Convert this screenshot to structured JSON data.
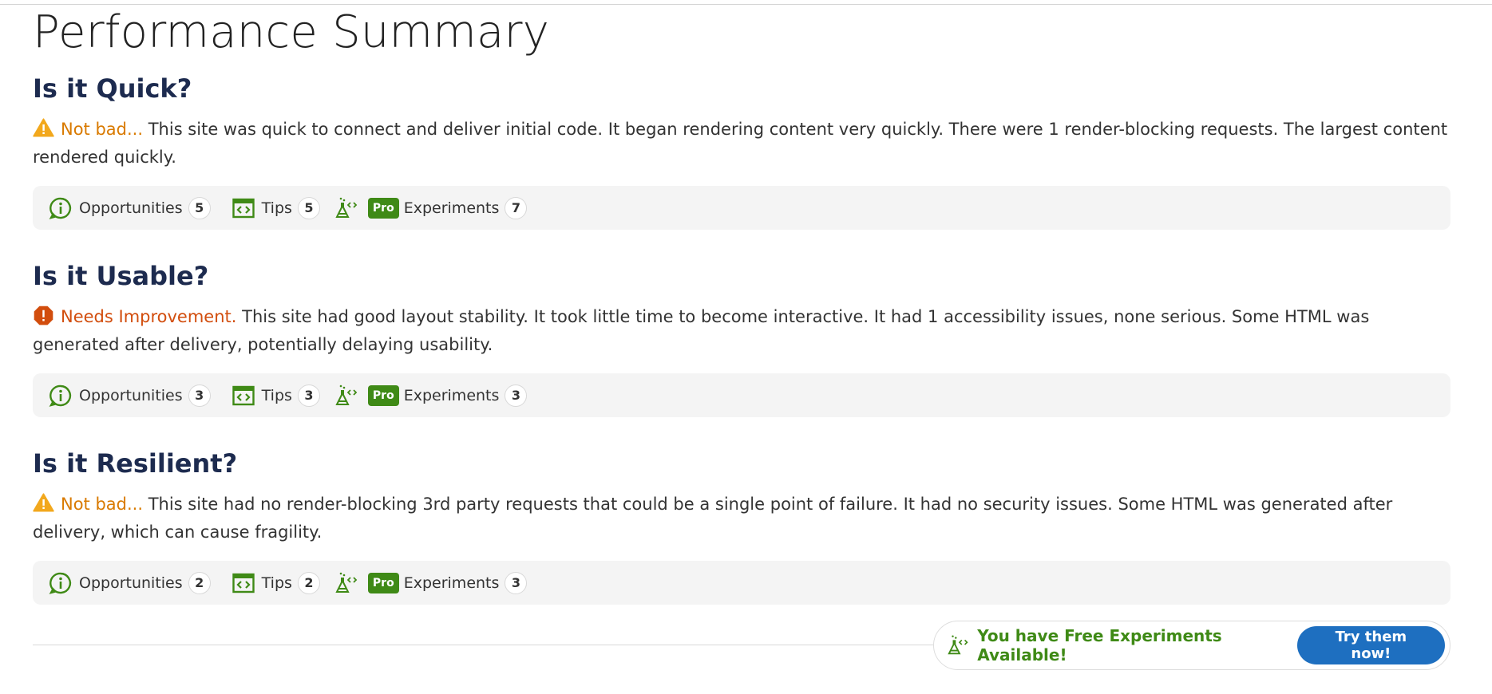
{
  "page": {
    "title": "Performance Summary"
  },
  "sections": [
    {
      "heading": "Is it Quick?",
      "verdict": "Not bad...",
      "verdict_level": "warning",
      "summary": "This site was quick to connect and deliver initial code. It began rendering content very quickly. There were 1 render-blocking requests. The largest content rendered quickly.",
      "opportunities_label": "Opportunities",
      "opportunities_count": "5",
      "tips_label": "Tips",
      "tips_count": "5",
      "pro_label": "Pro",
      "experiments_label": "Experiments",
      "experiments_count": "7"
    },
    {
      "heading": "Is it Usable?",
      "verdict": "Needs Improvement.",
      "verdict_level": "error",
      "summary": "This site had good layout stability. It took little time to become interactive. It had 1 accessibility issues, none serious. Some HTML was generated after delivery, potentially delaying usability.",
      "opportunities_label": "Opportunities",
      "opportunities_count": "3",
      "tips_label": "Tips",
      "tips_count": "3",
      "pro_label": "Pro",
      "experiments_label": "Experiments",
      "experiments_count": "3"
    },
    {
      "heading": "Is it Resilient?",
      "verdict": "Not bad...",
      "verdict_level": "warning",
      "summary": "This site had no render-blocking 3rd party requests that could be a single point of failure. It had no security issues. Some HTML was generated after delivery, which can cause fragility.",
      "opportunities_label": "Opportunities",
      "opportunities_count": "2",
      "tips_label": "Tips",
      "tips_count": "2",
      "pro_label": "Pro",
      "experiments_label": "Experiments",
      "experiments_count": "3"
    }
  ],
  "promo": {
    "text": "You have Free Experiments Available!",
    "button_label": "Try them now!"
  },
  "colors": {
    "heading": "#1d2b4f",
    "warning": "#d97a00",
    "error": "#d24d0d",
    "green": "#3f8a16",
    "button_blue": "#1e6fc0"
  },
  "icons": {
    "warning": "warning-triangle-icon",
    "error": "error-octagon-icon",
    "opportunities": "info-circle-icon",
    "tips": "code-window-icon",
    "experiments": "flask-icon"
  }
}
